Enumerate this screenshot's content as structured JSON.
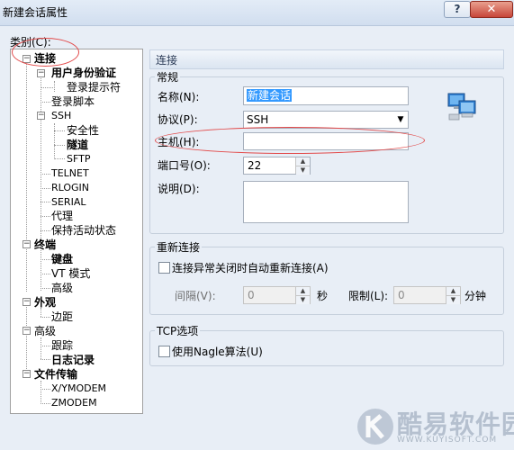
{
  "window": {
    "title": "新建会话属性",
    "help_label": "?",
    "close_label": "✕"
  },
  "category_label": "类别(C):",
  "tree": {
    "connection": "连接",
    "user_auth": "用户身份验证",
    "login_prompt": "登录提示符",
    "login_script": "登录脚本",
    "ssh": "SSH",
    "security": "安全性",
    "tunnel": "隧道",
    "sftp": "SFTP",
    "telnet": "TELNET",
    "rlogin": "RLOGIN",
    "serial": "SERIAL",
    "proxy": "代理",
    "keepalive": "保持活动状态",
    "terminal": "终端",
    "keyboard": "键盘",
    "vt_mode": "VT 模式",
    "advanced_terminal": "高级",
    "appearance": "外观",
    "margin": "边距",
    "advanced": "高级",
    "trace": "跟踪",
    "log": "日志记录",
    "file_transfer": "文件传输",
    "xymodem": "X/YMODEM",
    "zmodem": "ZMODEM"
  },
  "panel": {
    "header": "连接",
    "general": {
      "title": "常规",
      "name_label": "名称(N):",
      "name_value": "新建会话",
      "protocol_label": "协议(P):",
      "protocol_value": "SSH",
      "host_label": "主机(H):",
      "host_value": "",
      "port_label": "端口号(O):",
      "port_value": "22",
      "desc_label": "说明(D):",
      "desc_value": ""
    },
    "reconnect": {
      "title": "重新连接",
      "auto_label": "连接异常关闭时自动重新连接(A)",
      "interval_label": "间隔(V):",
      "interval_value": "0",
      "seconds_label": "秒",
      "limit_label": "限制(L):",
      "limit_value": "0",
      "minutes_label": "分钟"
    },
    "tcp": {
      "title": "TCP选项",
      "nagle_label": "使用Nagle算法(U)"
    }
  },
  "watermark": {
    "text": "酷易软件园",
    "url": "WWW.KUYISOFT.COM"
  },
  "colors": {
    "annotation": "#e24a4a",
    "selection": "#3399ff"
  }
}
